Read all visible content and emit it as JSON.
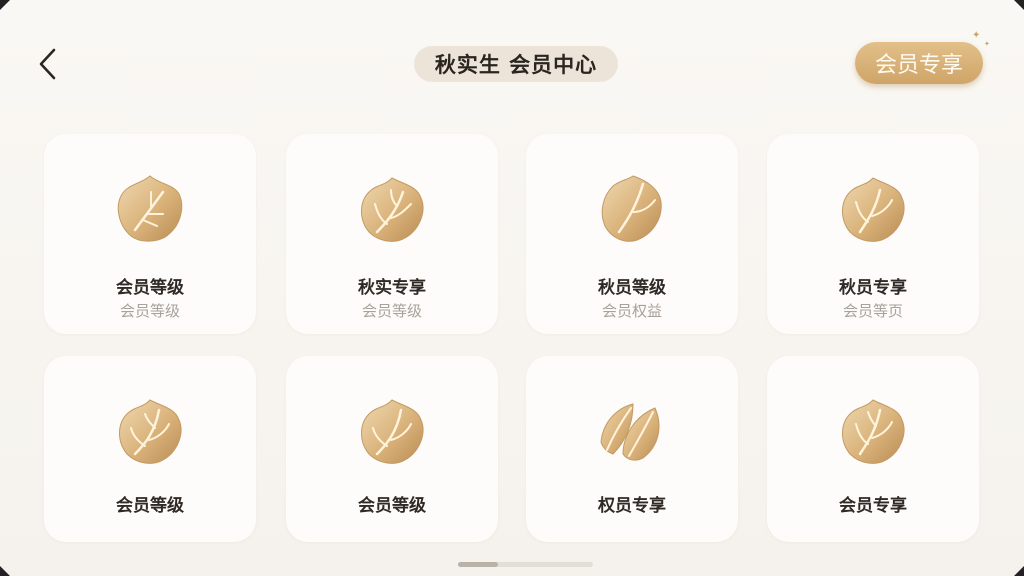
{
  "header": {
    "title": "秋实生  会员中心",
    "member_button_label": "会员专享"
  },
  "colors": {
    "accent": "#d4ab6e",
    "background": "#f7f4ef",
    "card": "#fdfcfa",
    "title_pill": "#ece4d9"
  },
  "cards": [
    {
      "label": "会员等级",
      "sub": "会员等级",
      "icon": "gold-leaf-icon"
    },
    {
      "label": "秋实专享",
      "sub": "会员等级",
      "icon": "gold-sprout-leaf-icon"
    },
    {
      "label": "秋员等级",
      "sub": "会员权益",
      "icon": "gold-leaf-icon"
    },
    {
      "label": "秋员专享",
      "sub": "会员等页",
      "icon": "gold-sprout-leaf-icon"
    },
    {
      "label": "会员等级",
      "icon": "gold-sprout-leaf-icon"
    },
    {
      "label": "会员等级",
      "icon": "gold-sprout-leaf-icon"
    },
    {
      "label": "权员专享",
      "icon": "gold-falling-leaf-icon"
    },
    {
      "label": "会员专享",
      "icon": "gold-sprout-leaf-icon"
    }
  ]
}
